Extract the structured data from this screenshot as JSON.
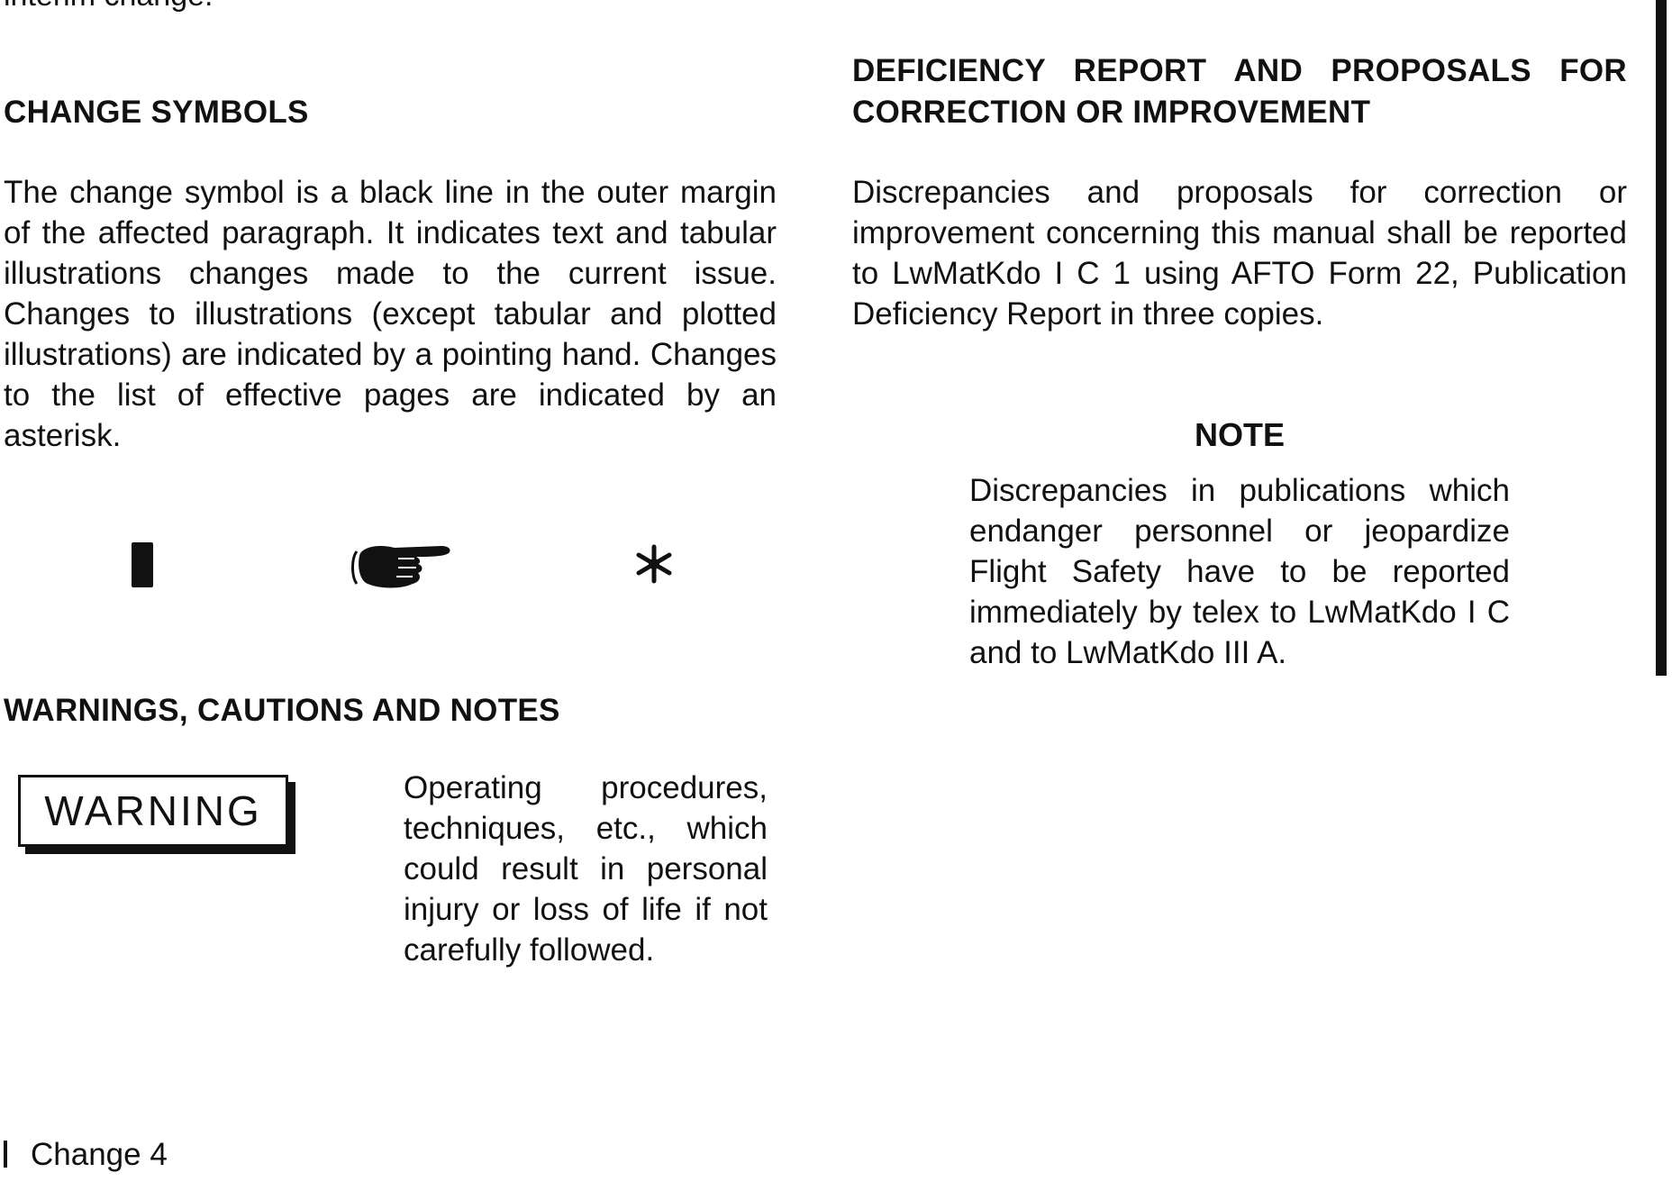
{
  "top_fragment": "interim change.",
  "left_column": {
    "change_symbols": {
      "heading": "CHANGE SYMBOLS",
      "paragraph": "The change symbol is a black line in the outer margin of the affected paragraph. It indicates text and tabular illustrations changes made to the current issue. Changes to illustrations (except tabular and plotted illustrations) are indicated by a pointing hand. Changes to the list of effective pages are indicated by an asterisk.",
      "symbols": [
        "change-bar-icon",
        "pointing-hand-icon",
        "asterisk-icon"
      ]
    },
    "warnings": {
      "heading": "WARNINGS, CAUTIONS AND NOTES",
      "warning_label": "WARNING",
      "warning_text": "Operating procedures, techniques, etc., which could result in personal injury or loss of life if not carefully followed."
    }
  },
  "right_column": {
    "deficiency": {
      "heading": "DEFICIENCY REPORT AND PROPOSALS FOR CORRECTION OR IMPROVEMENT",
      "paragraph": "Discrepancies and proposals for correction or improvement concerning this manual shall be reported to LwMatKdo I C 1 using AFTO Form 22, Publication Deficiency Report in three copies."
    },
    "note": {
      "title": "NOTE",
      "text": "Discrepancies in publications which endanger personnel or jeopardize Flight Safety have to be reported immediately by telex to LwMatKdo I C and to LwMatKdo III A."
    }
  },
  "footer": {
    "page_label": "Change 4"
  }
}
